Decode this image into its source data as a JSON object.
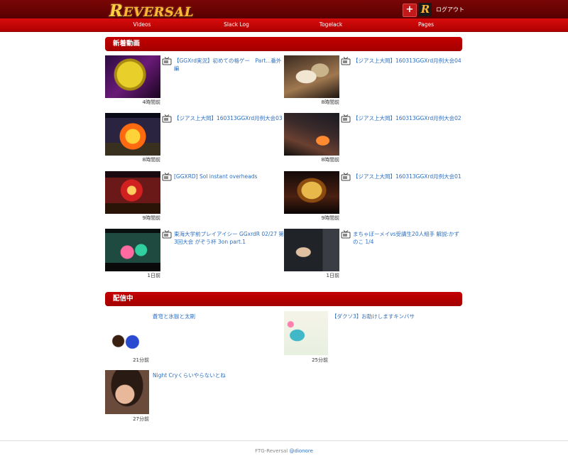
{
  "header": {
    "logo_text": "REVERSAL",
    "logo_initial": "R",
    "logo_rest": "EVERSAL",
    "plus_label": "+",
    "avatar_letter": "R",
    "logout_label": "ログアウト"
  },
  "nav": {
    "items": [
      "Videos",
      "Slack Log",
      "Togelack",
      "Pages"
    ]
  },
  "new_videos": {
    "heading": "新着動画",
    "items": [
      {
        "title": "【GGXrd実況】初めての格ゲー　Part...番外編",
        "time": "4時間前"
      },
      {
        "title": "【ジアス上大岡】160313GGXrd月例大会04",
        "time": "8時間前"
      },
      {
        "title": "【ジアス上大岡】160313GGXrd月例大会03",
        "time": "8時間前"
      },
      {
        "title": "【ジアス上大岡】160313GGXrd月例大会02",
        "time": "8時間前"
      },
      {
        "title": "[GGXRD] Sol instant overheads",
        "time": "9時間前"
      },
      {
        "title": "【ジアス上大岡】160313GGXrd月例大会01",
        "time": "9時間前"
      },
      {
        "title": "東海大学前プレイアイシー GGxrdR 02/27 第3回大会 がぞう杯 3on part.1",
        "time": "1日前"
      },
      {
        "title": "まちゃぼーメイvs受講生20人組手 解説:かずのこ 1/4",
        "time": "1日前"
      }
    ]
  },
  "live": {
    "heading": "配信中",
    "items": [
      {
        "title": "蒼穹と氷獄と太刷",
        "time": "21分前"
      },
      {
        "title": "【ダクソ3】お助けしますキンバサ",
        "time": "25分前"
      },
      {
        "title": "Night Cryくらいやらないとね",
        "time": "27分前"
      }
    ]
  },
  "footer": {
    "text": "FTG-Reversal",
    "author": "@dionore"
  },
  "colors": {
    "header_dark": "#6b0000",
    "nav_red": "#c80000",
    "section_red": "#b80000",
    "link_blue": "#2d6fc0",
    "logo_gold": "#ffb733"
  }
}
